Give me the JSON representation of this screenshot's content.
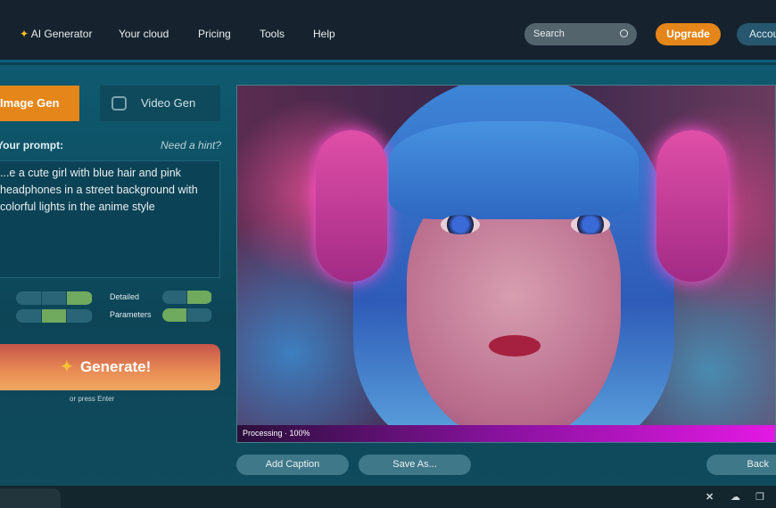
{
  "header": {
    "nav": [
      "AI Generator",
      "Your cloud",
      "Pricing",
      "Tools",
      "Help"
    ],
    "search_placeholder": "Search",
    "upgrade": "Upgrade",
    "account": "Account"
  },
  "left": {
    "tabs": [
      {
        "label": "Image Gen",
        "active": true
      },
      {
        "label": "Video Gen",
        "active": false
      }
    ],
    "prompt_label": "Your prompt:",
    "prompt_hint": "Need a hint?",
    "prompt_text": "...e a cute girl with blue hair and pink headphones in a street background with colorful lights in the anime style",
    "options": [
      {
        "label": "Detailed"
      },
      {
        "label": "Parameters"
      }
    ],
    "generate": "Generate!",
    "generate_hint": "or press Enter"
  },
  "preview": {
    "status": "Processing · 100%",
    "progress_percent": 100
  },
  "actions": {
    "add": "Add Caption",
    "save": "Save As...",
    "back": "Back"
  },
  "colors": {
    "accent": "#e5861a",
    "header": "#16232e",
    "panel": "#0f4a5c",
    "toggle_on": "#6faa5e"
  }
}
